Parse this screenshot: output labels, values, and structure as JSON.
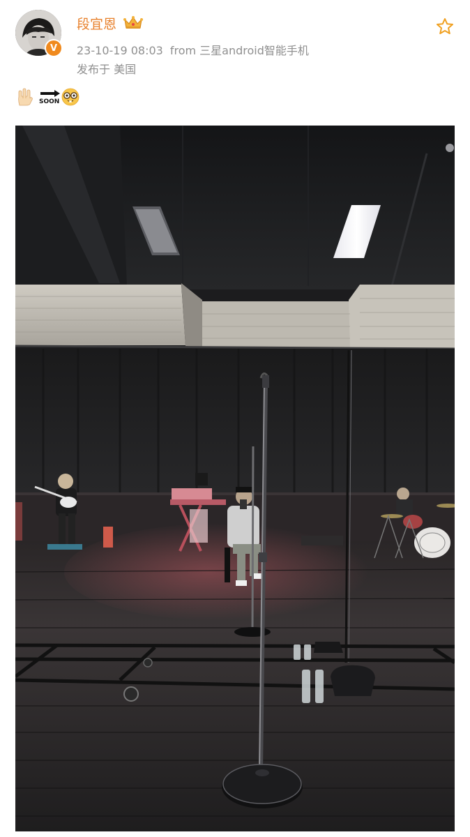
{
  "post": {
    "author": {
      "name": "段宜恩",
      "verified_icon": "verified-badge-icon",
      "badge_icon": "crown-icon"
    },
    "timestamp": "23-10-19 08:03",
    "source": "from 三星android智能手机",
    "location": "发布于 美国",
    "content": {
      "soon_label": "SOON",
      "emojis": [
        "love-you-hand-emoji",
        "soon-arrow-emoji",
        "nerd-face-emoji"
      ]
    },
    "favorite_icon": "star-outline-icon",
    "photo_description_icon": "image"
  },
  "colors": {
    "username": "#e8812c",
    "meta": "#8f8f8f",
    "star": "#f0a020",
    "verified": "#f08a1e"
  }
}
